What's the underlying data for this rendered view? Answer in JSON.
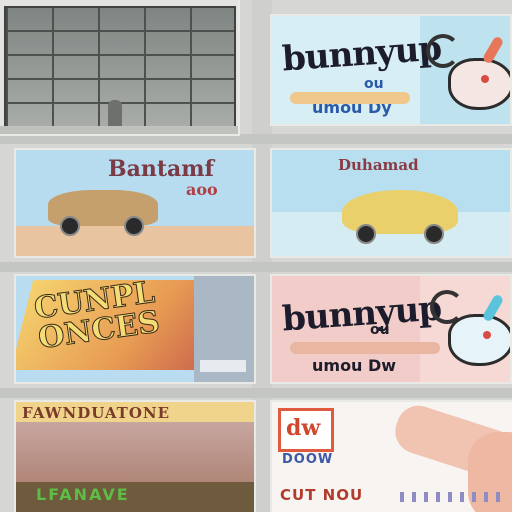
{
  "scene": "Wall of billboard advertisements",
  "tiles": {
    "bunny_top": {
      "brand": "bunnyup",
      "subline": "ou",
      "slogan": "umou Dy"
    },
    "car_left": {
      "headline": "Bantamf",
      "sub": "aoo"
    },
    "car_right": {
      "headline": "Duhamad"
    },
    "comic": {
      "text_1": "CUNPL",
      "text_2": "ONCES"
    },
    "bunny_pink": {
      "brand": "bunnyup",
      "subline": "ou",
      "slogan": "umou Dw"
    },
    "street": {
      "title": "FAWNDUATONE",
      "footer": "LFANAVE"
    },
    "hand": {
      "logo": "dw",
      "code": "DOOW",
      "caption": "CUT NOU"
    }
  }
}
